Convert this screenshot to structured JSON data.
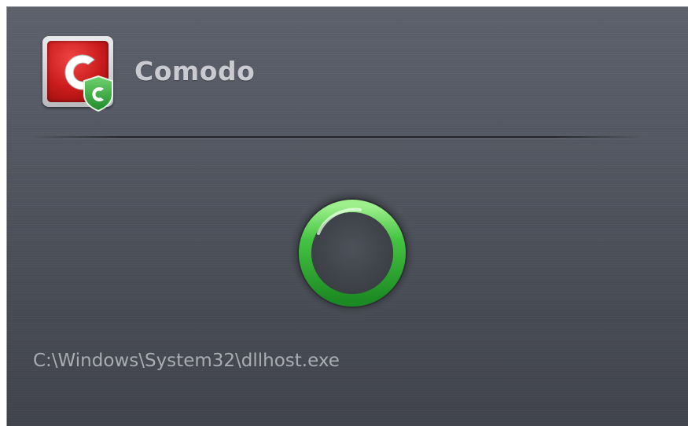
{
  "header": {
    "app_name": "Comodo",
    "logo_icon": "comodo-logo-icon",
    "logo_letter": "C",
    "badge_letter": "C"
  },
  "status": {
    "indicator_icon": "green-ring-icon",
    "indicator_color": "#3fb63f"
  },
  "file": {
    "path": "C:\\Windows\\System32\\dllhost.exe"
  },
  "colors": {
    "logo_red": "#c81a1a",
    "badge_green": "#2fa035",
    "text_primary": "#c9cbd0",
    "text_secondary": "#a9acb3"
  }
}
